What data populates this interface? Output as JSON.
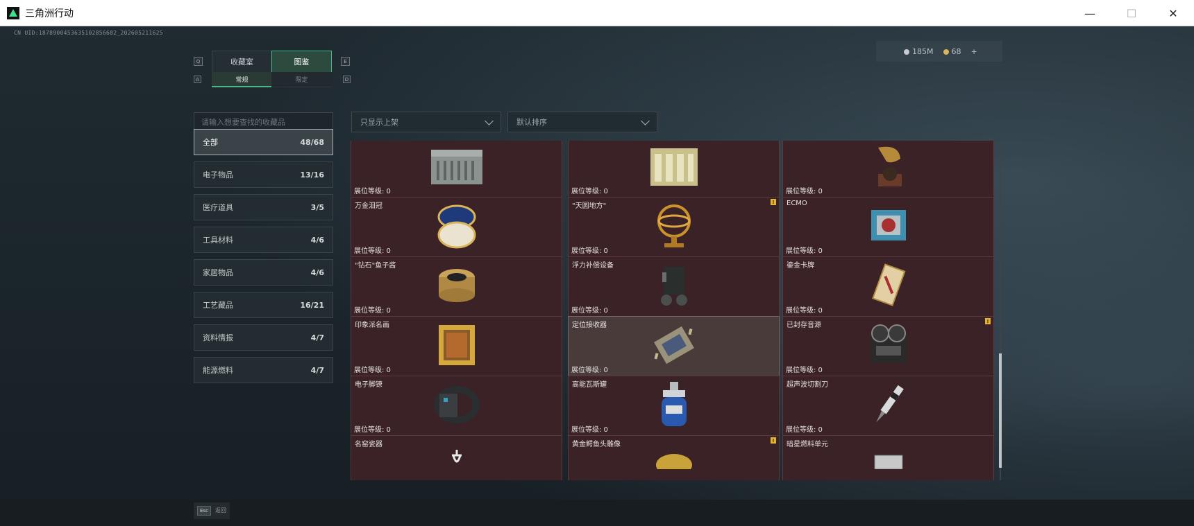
{
  "window": {
    "title": "三角洲行动",
    "minimize": "—",
    "maximize": "☐",
    "close": "✕"
  },
  "uid": "CN UID:1878900453635102856682_202605211625",
  "currency": {
    "silver": "185M",
    "gold": "68",
    "add": "+"
  },
  "keys": {
    "prev_tab": "Q",
    "next_tab": "E",
    "prev_sub": "A",
    "next_sub": "D",
    "esc": "Esc"
  },
  "tabs": [
    {
      "label": "收藏室"
    },
    {
      "label": "图鉴"
    }
  ],
  "subtabs": [
    {
      "label": "常规"
    },
    {
      "label": "限定"
    }
  ],
  "search": {
    "placeholder": "请输入想要查找的收藏品"
  },
  "filters": {
    "shelf": "只显示上架",
    "sort": "默认排序"
  },
  "categories": [
    {
      "label": "全部",
      "count": "48/68"
    },
    {
      "label": "电子物品",
      "count": "13/16"
    },
    {
      "label": "医疗道具",
      "count": "3/5"
    },
    {
      "label": "工具材料",
      "count": "4/6"
    },
    {
      "label": "家居物品",
      "count": "4/6"
    },
    {
      "label": "工艺藏品",
      "count": "16/21"
    },
    {
      "label": "资料情报",
      "count": "4/7"
    },
    {
      "label": "能源燃料",
      "count": "4/7"
    }
  ],
  "level_label": "展位等级: 0",
  "items": [
    {
      "name": "",
      "icon": "battery-icon",
      "badge": ""
    },
    {
      "name": "",
      "icon": "power-bank-icon",
      "badge": ""
    },
    {
      "name": "",
      "icon": "gramophone-icon",
      "badge": ""
    },
    {
      "name": "万金泪冠",
      "icon": "jeweled-egg-icon",
      "badge": ""
    },
    {
      "name": "\"天圆地方\"",
      "icon": "armillary-sphere-icon",
      "badge": "!"
    },
    {
      "name": "ECMO",
      "icon": "ecmo-machine-icon",
      "badge": ""
    },
    {
      "name": "\"钻石\"鱼子酱",
      "icon": "caviar-tin-icon",
      "badge": ""
    },
    {
      "name": "浮力补偿设备",
      "icon": "buoyancy-device-icon",
      "badge": ""
    },
    {
      "name": "鎏金卡牌",
      "icon": "gilded-card-icon",
      "badge": ""
    },
    {
      "name": "印象派名画",
      "icon": "painting-icon",
      "badge": ""
    },
    {
      "name": "定位接收器",
      "icon": "gps-receiver-icon",
      "badge": ""
    },
    {
      "name": "已封存音源",
      "icon": "tape-recorder-icon",
      "badge": "!"
    },
    {
      "name": "电子脚镣",
      "icon": "ankle-monitor-icon",
      "badge": ""
    },
    {
      "name": "高能瓦斯罐",
      "icon": "gas-canister-icon",
      "badge": ""
    },
    {
      "name": "超声波切割刀",
      "icon": "ultrasonic-cutter-icon",
      "badge": ""
    },
    {
      "name": "名窑瓷器",
      "icon": "porcelain-icon",
      "badge": ""
    },
    {
      "name": "黄金鳄鱼头雕像",
      "icon": "gold-croc-statue-icon",
      "badge": "!"
    },
    {
      "name": "暗星燃料单元",
      "icon": "fuel-cell-icon",
      "badge": ""
    }
  ],
  "footer": {
    "back_label": "返回"
  }
}
